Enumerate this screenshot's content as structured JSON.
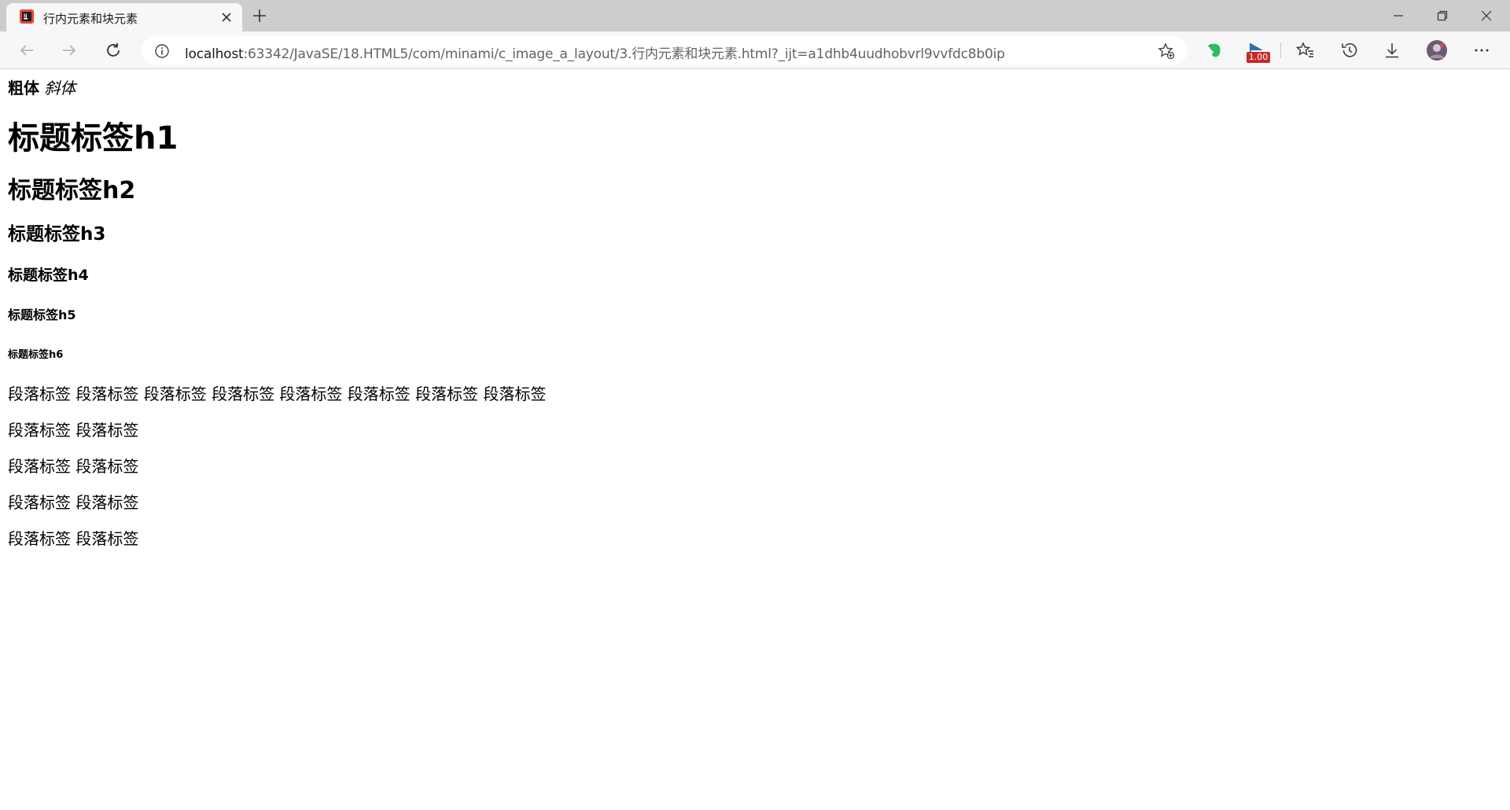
{
  "browser": {
    "tab_title": "行内元素和块元素",
    "address_host": "localhost",
    "address_rest": ":63342/JavaSE/18.HTML5/com/minami/c_image_a_layout/3.行内元素和块元素.html?_ijt=a1dhb4uudhobvrl9vvfdc8b0ip",
    "extension_badge": "1.00"
  },
  "page": {
    "bold_text": "粗体",
    "italic_text": "斜体",
    "h1": "标题标签h1",
    "h2": "标题标签h2",
    "h3": "标题标签h3",
    "h4": "标题标签h4",
    "h5": "标题标签h5",
    "h6": "标题标签h6",
    "paragraph_1": "段落标签 段落标签 段落标签 段落标签 段落标签 段落标签 段落标签 段落标签",
    "paragraph_2": "段落标签 段落标签",
    "paragraph_3": "段落标签 段落标签",
    "paragraph_4": "段落标签 段落标签",
    "paragraph_5": "段落标签 段落标签"
  },
  "colors": {
    "titlebar": "#cdcdcd",
    "toolbar": "#f7f7f7",
    "badge": "#c62828",
    "evernote": "#2dbe60"
  }
}
